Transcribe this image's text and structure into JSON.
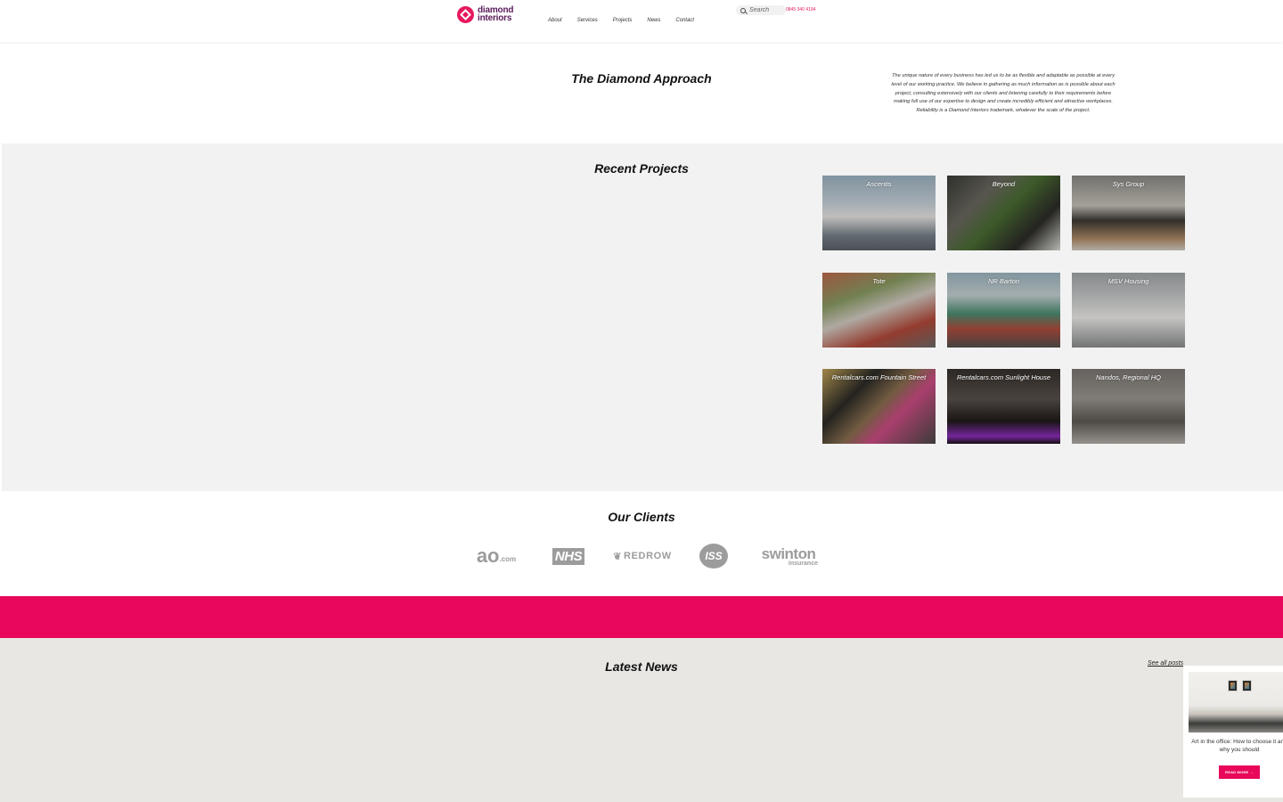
{
  "header": {
    "logo_line1": "diamond",
    "logo_line2": "interiors",
    "nav": [
      "About",
      "Services",
      "Projects",
      "News",
      "Contact"
    ],
    "search_placeholder": "Search",
    "phone": "0845 340 4194"
  },
  "approach": {
    "title": "The Diamond Approach",
    "text": "The unique nature of every business has led us to be as flexible and adaptable as possible at every level of our working practice. We believe in gathering as much information as is possible about each project, consulting extensively with our clients and listening carefully to their requirements before making full use of our expertise to design and create incredibly efficient and attractive workplaces. Reliability is a Diamond Interiors trademark, whatever the scale of the project."
  },
  "projects": {
    "title": "Recent Projects",
    "items": [
      {
        "name": "Ascentis"
      },
      {
        "name": "Beyond"
      },
      {
        "name": "Sys Group"
      },
      {
        "name": "Tote"
      },
      {
        "name": "NR Barton"
      },
      {
        "name": "MSV Housing"
      },
      {
        "name": "Rentalcars.com Fountain Street"
      },
      {
        "name": "Rentalcars.com Sunlight House"
      },
      {
        "name": "Nandos, Regional HQ"
      }
    ]
  },
  "clients": {
    "title": "Our Clients",
    "ao": "ao",
    "ao_suffix": ".com",
    "nhs": "NHS",
    "redrow": "REDROW",
    "iss": "ISS",
    "swinton": "swinton",
    "swinton_sub": "insurance"
  },
  "news": {
    "title": "Latest News",
    "see_all": "See all posts",
    "card_text_line1": "Art in the office: How to choose it and",
    "card_text_line2": "why you should",
    "read_more": "READ MORE →"
  },
  "colors": {
    "brand_pink": "#e8075a",
    "logo_purple": "#5a1a5a"
  }
}
